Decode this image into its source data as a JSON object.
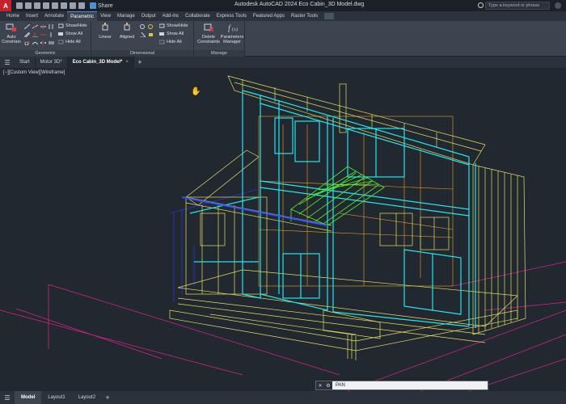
{
  "titlebar": {
    "app_logo": "A",
    "share_label": "Share",
    "title": "Autodesk AutoCAD 2024   Eco Cabin_3D Model.dwg",
    "search_placeholder": "Type a keyword or phrase"
  },
  "ribbon_tabs": [
    "Home",
    "Insert",
    "Annotate",
    "Parametric",
    "View",
    "Manage",
    "Output",
    "Add-ins",
    "Collaborate",
    "Express Tools",
    "Featured Apps",
    "Raster Tools"
  ],
  "active_ribbon_tab": "Parametric",
  "ribbon": {
    "geometric": {
      "label": "Geometric",
      "auto_constrain_line1": "Auto",
      "auto_constrain_line2": "Constrain",
      "show_hide": "Show/Hide",
      "show_all": "Show All",
      "hide_all": "Hide All"
    },
    "dimensional": {
      "label": "Dimensional",
      "linear": "Linear",
      "aligned": "Aligned",
      "show_hide": "Show/Hide",
      "show_all": "Show All",
      "hide_all": "Hide All"
    },
    "manage": {
      "label": "Manage",
      "delete_line1": "Delete",
      "delete_line2": "Constraints",
      "params_line1": "Parameters",
      "params_line2": "Manager"
    }
  },
  "doc_tabs": [
    {
      "label": "Start"
    },
    {
      "label": "Motor 3D*"
    },
    {
      "label": "Eco Cabin_3D Model*"
    }
  ],
  "active_doc_tab": "Eco Cabin_3D Model*",
  "viewport": {
    "view_label": "[−][Custom View][Wireframe]"
  },
  "command_line": {
    "text": "PAN"
  },
  "layout_tabs": [
    "Model",
    "Layout1",
    "Layout2"
  ],
  "active_layout_tab": "Model",
  "colors": {
    "cyan": "#22e6f0",
    "yellow": "#e8e060",
    "green": "#54f030",
    "magenta": "#e0208c",
    "orange": "#f0a020",
    "blue": "#3030e0"
  }
}
